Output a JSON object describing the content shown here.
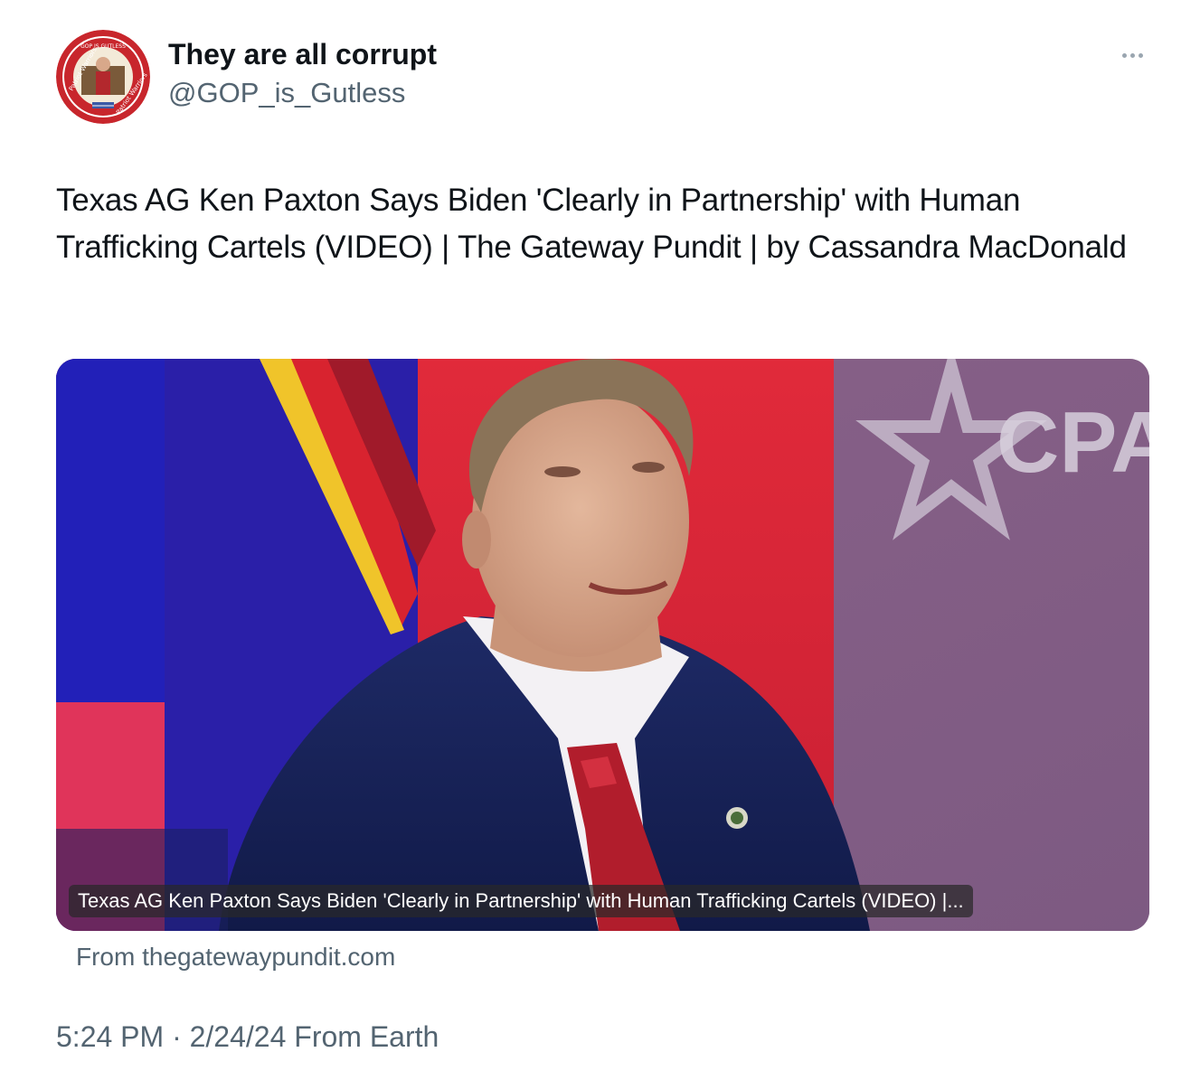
{
  "author": {
    "display_name": "They are all corrupt",
    "handle": "@GOP_is_Gutless",
    "avatar_badge_text": "GOP IS GUTLESS",
    "avatar_ring_text_left": "Patriot Warriors",
    "avatar_ring_text_right": "Patriot Warriors"
  },
  "tweet": {
    "text": "Texas AG Ken Paxton Says Biden 'Clearly in Partnership' with Human Trafficking Cartels (VIDEO) | The Gateway Pundit | by Cassandra MacDonald"
  },
  "card": {
    "title": "Texas AG Ken Paxton Says Biden 'Clearly in Partnership' with Human Trafficking Cartels (VIDEO) |...",
    "source": "From thegatewaypundit.com",
    "background_text": "CPAC"
  },
  "meta": {
    "time": "5:24 PM",
    "separator": " · ",
    "date": "2/24/24",
    "location": " From Earth"
  },
  "colors": {
    "text_primary": "#0f1419",
    "text_secondary": "#536471",
    "avatar_ring": "#c8262c"
  },
  "icons": {
    "more": "more-horizontal-icon"
  }
}
